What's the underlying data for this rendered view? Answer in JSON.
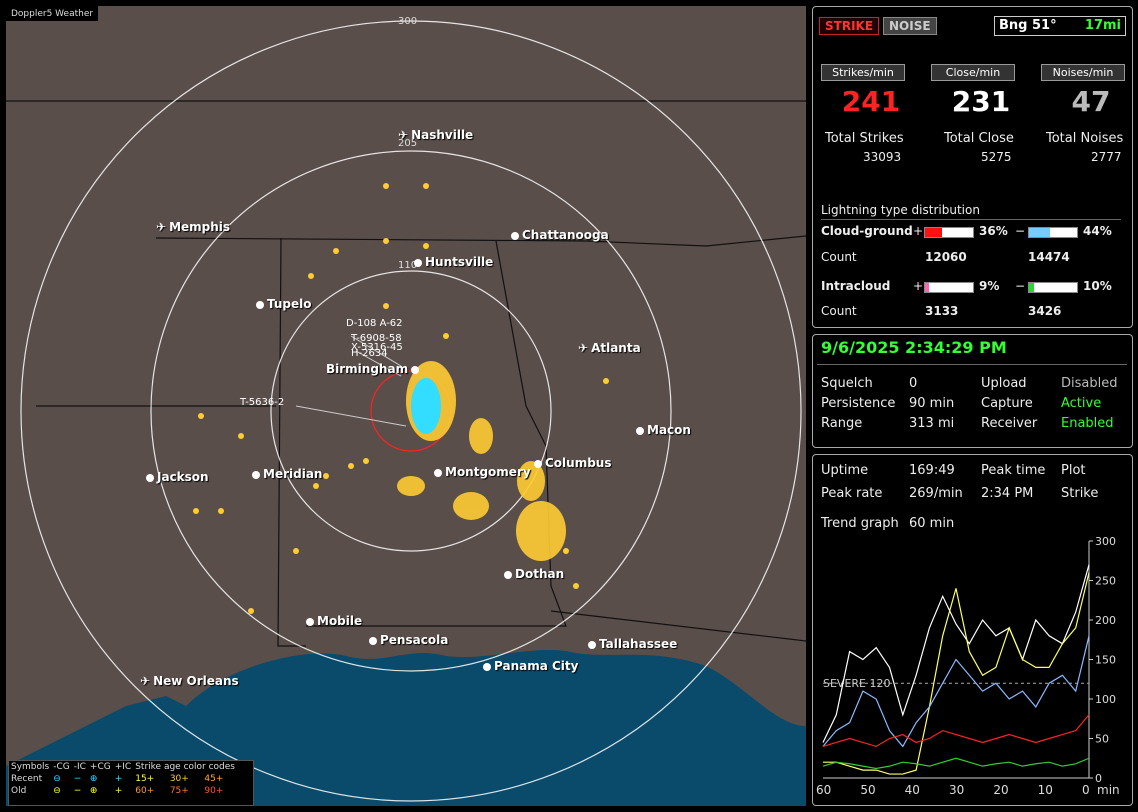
{
  "map": {
    "title": "Doppler5 Weather",
    "range_labels": [
      "300",
      "205",
      "110"
    ],
    "cities": [
      {
        "name": "Nashville",
        "plane": true
      },
      {
        "name": "Memphis",
        "plane": true
      },
      {
        "name": "Chattanooga",
        "plane": false
      },
      {
        "name": "Huntsville",
        "plane": false
      },
      {
        "name": "Tupelo",
        "plane": false
      },
      {
        "name": "Atlanta",
        "plane": true
      },
      {
        "name": "Birmingham",
        "plane": false
      },
      {
        "name": "Macon",
        "plane": false
      },
      {
        "name": "Jackson",
        "plane": false
      },
      {
        "name": "Meridian",
        "plane": false
      },
      {
        "name": "Montgomery",
        "plane": false
      },
      {
        "name": "Columbus",
        "plane": false
      },
      {
        "name": "Dothan",
        "plane": false
      },
      {
        "name": "Mobile",
        "plane": false
      },
      {
        "name": "Pensacola",
        "plane": false
      },
      {
        "name": "Tallahassee",
        "plane": false
      },
      {
        "name": "Panama City",
        "plane": false
      },
      {
        "name": "New Orleans",
        "plane": true
      }
    ],
    "storm_tags": [
      "D-108 A-62",
      "T-6908-58",
      "X-5316-45",
      "H-2634",
      "T-5636-2"
    ],
    "legend": {
      "symbols_label": "Symbols",
      "cols": [
        "-CG",
        "-IC",
        "+CG",
        "+IC"
      ],
      "age_label": "Strike age color codes",
      "recent_label": "Recent",
      "old_label": "Old",
      "recent_ages": [
        "15+",
        "30+",
        "45+"
      ],
      "old_ages": [
        "60+",
        "75+",
        "90+"
      ]
    }
  },
  "top": {
    "strike_btn": "STRIKE",
    "noise_btn": "NOISE",
    "bearing": "Bng 51°",
    "distance": "17mi"
  },
  "stats": {
    "strikes_hdr": "Strikes/min",
    "close_hdr": "Close/min",
    "noises_hdr": "Noises/min",
    "strikes": "241",
    "close": "231",
    "noises": "47",
    "total_strikes_lbl": "Total Strikes",
    "total_close_lbl": "Total Close",
    "total_noises_lbl": "Total Noises",
    "total_strikes": "33093",
    "total_close": "5275",
    "total_noises": "2777"
  },
  "dist": {
    "title": "Lightning type distribution",
    "cg_lbl": "Cloud-ground",
    "ic_lbl": "Intracloud",
    "count_lbl": "Count",
    "plus": "+",
    "minus": "−",
    "cg_pos_pct": "36%",
    "cg_neg_pct": "44%",
    "cg_pos_count": "12060",
    "cg_neg_count": "14474",
    "ic_pos_pct": "9%",
    "ic_neg_pct": "10%",
    "ic_pos_count": "3133",
    "ic_neg_count": "3426",
    "cg_pos_frac": 0.36,
    "cg_neg_frac": 0.44,
    "ic_pos_frac": 0.09,
    "ic_neg_frac": 0.1
  },
  "status": {
    "datetime": "9/6/2025 2:34:29 PM",
    "squelch_lbl": "Squelch",
    "squelch": "0",
    "persist_lbl": "Persistence",
    "persist": "90 min",
    "range_lbl": "Range",
    "range": "313 mi",
    "upload_lbl": "Upload",
    "upload": "Disabled",
    "capture_lbl": "Capture",
    "capture": "Active",
    "receiver_lbl": "Receiver",
    "receiver": "Enabled"
  },
  "trend": {
    "uptime_lbl": "Uptime",
    "uptime": "169:49",
    "peaktime_lbl": "Peak time",
    "peaktime": "2:34 PM",
    "plot_lbl": "Plot",
    "plot": "Strike",
    "peakrate_lbl": "Peak rate",
    "peakrate": "269/min",
    "graph_lbl": "Trend graph",
    "graph": "60 min",
    "severe_lbl": "SEVERE 120",
    "y_ticks": [
      "300",
      "250",
      "200",
      "150",
      "100",
      "50",
      "0"
    ],
    "x_ticks": [
      "60",
      "50",
      "40",
      "30",
      "20",
      "10",
      "0"
    ],
    "x_unit": "min"
  },
  "chart_data": {
    "type": "line",
    "xlim": [
      60,
      0
    ],
    "ylim": [
      0,
      300
    ],
    "x": [
      60,
      57,
      54,
      51,
      48,
      45,
      42,
      39,
      36,
      33,
      30,
      27,
      24,
      21,
      18,
      15,
      12,
      9,
      6,
      3,
      0
    ],
    "series": [
      {
        "color": "#ffffff",
        "values": [
          45,
          80,
          160,
          150,
          165,
          140,
          80,
          130,
          190,
          230,
          195,
          170,
          200,
          180,
          190,
          150,
          200,
          180,
          170,
          210,
          270
        ]
      },
      {
        "color": "#ffff66",
        "values": [
          20,
          20,
          15,
          10,
          10,
          5,
          5,
          10,
          90,
          180,
          240,
          160,
          130,
          140,
          190,
          150,
          140,
          140,
          170,
          190,
          260
        ]
      },
      {
        "color": "#88bbff",
        "values": [
          40,
          60,
          70,
          110,
          100,
          60,
          40,
          70,
          90,
          120,
          150,
          130,
          110,
          120,
          100,
          110,
          90,
          120,
          130,
          110,
          180
        ]
      },
      {
        "color": "#ff2222",
        "values": [
          40,
          45,
          50,
          45,
          40,
          50,
          55,
          45,
          50,
          60,
          55,
          50,
          45,
          50,
          55,
          50,
          45,
          50,
          55,
          60,
          80
        ]
      },
      {
        "color": "#33cc33",
        "values": [
          15,
          20,
          18,
          15,
          12,
          15,
          20,
          18,
          15,
          20,
          25,
          20,
          15,
          18,
          20,
          15,
          18,
          20,
          15,
          18,
          25
        ]
      }
    ]
  }
}
